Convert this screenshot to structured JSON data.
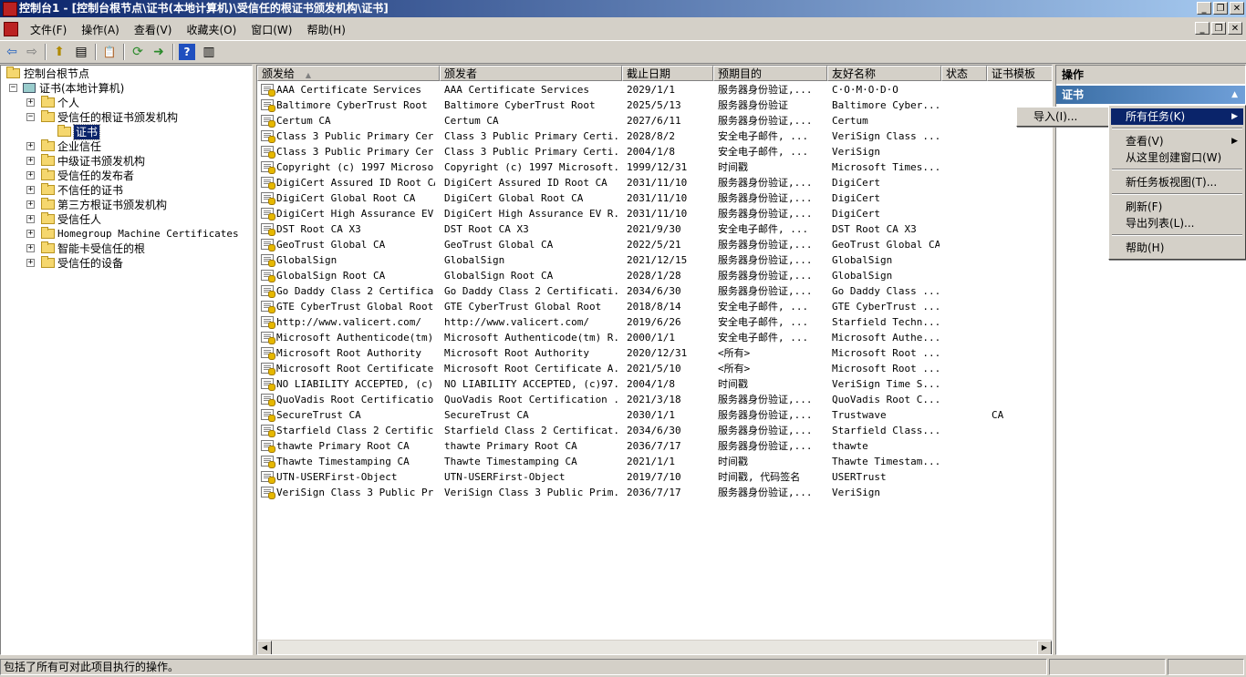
{
  "window": {
    "title": "控制台1 - [控制台根节点\\证书(本地计算机)\\受信任的根证书颁发机构\\证书]",
    "minimize": "_",
    "restore": "❐",
    "close": "✕"
  },
  "menubar": {
    "items": [
      "文件(F)",
      "操作(A)",
      "查看(V)",
      "收藏夹(O)",
      "窗口(W)",
      "帮助(H)"
    ]
  },
  "toolbar": {
    "back": "⇦",
    "forward": "⇨",
    "up": "⬆",
    "show_hide_tree": "▤",
    "properties": "📋",
    "refresh": "⟳",
    "export": "➜",
    "help": "?",
    "show_hide_action": "▥"
  },
  "tree": {
    "root": "控制台根节点",
    "computer": "证书(本地计算机)",
    "nodes": [
      {
        "label": "个人",
        "expandable": true
      },
      {
        "label": "受信任的根证书颁发机构",
        "expandable": false,
        "expanded": true
      },
      {
        "label": "证书",
        "selected": true,
        "child": true
      },
      {
        "label": "企业信任",
        "expandable": true
      },
      {
        "label": "中级证书颁发机构",
        "expandable": true
      },
      {
        "label": "受信任的发布者",
        "expandable": true
      },
      {
        "label": "不信任的证书",
        "expandable": true
      },
      {
        "label": "第三方根证书颁发机构",
        "expandable": true
      },
      {
        "label": "受信任人",
        "expandable": true
      },
      {
        "label": "Homegroup Machine Certificates",
        "expandable": true
      },
      {
        "label": "智能卡受信任的根",
        "expandable": true
      },
      {
        "label": "受信任的设备",
        "expandable": true
      }
    ]
  },
  "list": {
    "sort_indicator": "▲",
    "columns": [
      "颁发给",
      "颁发者",
      "截止日期",
      "预期目的",
      "友好名称",
      "状态",
      "证书模板"
    ],
    "rows": [
      [
        "AAA Certificate Services",
        "AAA Certificate Services",
        "2029/1/1",
        "服务器身份验证,...",
        "C·O·M·O·D·O",
        "",
        ""
      ],
      [
        "Baltimore CyberTrust Root",
        "Baltimore CyberTrust Root",
        "2025/5/13",
        "服务器身份验证",
        "Baltimore Cyber...",
        "",
        ""
      ],
      [
        "Certum CA",
        "Certum CA",
        "2027/6/11",
        "服务器身份验证,...",
        "Certum",
        "",
        ""
      ],
      [
        "Class 3 Public Primary Cer...",
        "Class 3 Public Primary Certi...",
        "2028/8/2",
        "安全电子邮件, ...",
        "VeriSign Class ...",
        "",
        ""
      ],
      [
        "Class 3 Public Primary Cer...",
        "Class 3 Public Primary Certi...",
        "2004/1/8",
        "安全电子邮件, ...",
        "VeriSign",
        "",
        ""
      ],
      [
        "Copyright (c) 1997 Microso...",
        "Copyright (c) 1997 Microsoft...",
        "1999/12/31",
        "时间戳",
        "Microsoft Times...",
        "",
        ""
      ],
      [
        "DigiCert Assured ID Root CA",
        "DigiCert Assured ID Root CA",
        "2031/11/10",
        "服务器身份验证,...",
        "DigiCert",
        "",
        ""
      ],
      [
        "DigiCert Global Root CA",
        "DigiCert Global Root CA",
        "2031/11/10",
        "服务器身份验证,...",
        "DigiCert",
        "",
        ""
      ],
      [
        "DigiCert High Assurance EV...",
        "DigiCert High Assurance EV R...",
        "2031/11/10",
        "服务器身份验证,...",
        "DigiCert",
        "",
        ""
      ],
      [
        "DST Root CA X3",
        "DST Root CA X3",
        "2021/9/30",
        "安全电子邮件, ...",
        "DST Root CA X3",
        "",
        ""
      ],
      [
        "GeoTrust Global CA",
        "GeoTrust Global CA",
        "2022/5/21",
        "服务器身份验证,...",
        "GeoTrust Global CA",
        "",
        ""
      ],
      [
        "GlobalSign",
        "GlobalSign",
        "2021/12/15",
        "服务器身份验证,...",
        "GlobalSign",
        "",
        ""
      ],
      [
        "GlobalSign Root CA",
        "GlobalSign Root CA",
        "2028/1/28",
        "服务器身份验证,...",
        "GlobalSign",
        "",
        ""
      ],
      [
        "Go Daddy Class 2 Certifica...",
        "Go Daddy Class 2 Certificati...",
        "2034/6/30",
        "服务器身份验证,...",
        "Go Daddy Class ...",
        "",
        ""
      ],
      [
        "GTE CyberTrust Global Root",
        "GTE CyberTrust Global Root",
        "2018/8/14",
        "安全电子邮件, ...",
        "GTE CyberTrust ...",
        "",
        ""
      ],
      [
        "http://www.valicert.com/",
        "http://www.valicert.com/",
        "2019/6/26",
        "安全电子邮件, ...",
        "Starfield Techn...",
        "",
        ""
      ],
      [
        "Microsoft Authenticode(tm)...",
        "Microsoft Authenticode(tm) R...",
        "2000/1/1",
        "安全电子邮件, ...",
        "Microsoft Authe...",
        "",
        ""
      ],
      [
        "Microsoft Root Authority",
        "Microsoft Root Authority",
        "2020/12/31",
        "<所有>",
        "Microsoft Root ...",
        "",
        ""
      ],
      [
        "Microsoft Root Certificate...",
        "Microsoft Root Certificate A...",
        "2021/5/10",
        "<所有>",
        "Microsoft Root ...",
        "",
        ""
      ],
      [
        "NO LIABILITY ACCEPTED, (c)...",
        "NO LIABILITY ACCEPTED, (c)97...",
        "2004/1/8",
        "时间戳",
        "VeriSign Time S...",
        "",
        ""
      ],
      [
        "QuoVadis Root Certificatio...",
        "QuoVadis Root Certification ...",
        "2021/3/18",
        "服务器身份验证,...",
        "QuoVadis Root C...",
        "",
        ""
      ],
      [
        "SecureTrust CA",
        "SecureTrust CA",
        "2030/1/1",
        "服务器身份验证,...",
        "Trustwave",
        "",
        "CA"
      ],
      [
        "Starfield Class 2 Certific...",
        "Starfield Class 2 Certificat...",
        "2034/6/30",
        "服务器身份验证,...",
        "Starfield Class...",
        "",
        ""
      ],
      [
        "thawte Primary Root CA",
        "thawte Primary Root CA",
        "2036/7/17",
        "服务器身份验证,...",
        "thawte",
        "",
        ""
      ],
      [
        "Thawte Timestamping CA",
        "Thawte Timestamping CA",
        "2021/1/1",
        "时间戳",
        "Thawte Timestam...",
        "",
        ""
      ],
      [
        "UTN-USERFirst-Object",
        "UTN-USERFirst-Object",
        "2019/7/10",
        "时间戳, 代码签名",
        "USERTrust",
        "",
        ""
      ],
      [
        "VeriSign Class 3 Public Pr...",
        "VeriSign Class 3 Public Prim...",
        "2036/7/17",
        "服务器身份验证,...",
        "VeriSign",
        "",
        ""
      ]
    ],
    "scroll_left": "◀",
    "scroll_right": "▶"
  },
  "actions": {
    "header": "操作",
    "section": "证书",
    "collapse": "▲"
  },
  "context_menu": {
    "items": [
      {
        "label": "所有任务(K)",
        "highlighted": true,
        "submenu": true
      },
      {
        "separator": true
      },
      {
        "label": "查看(V)",
        "submenu": true
      },
      {
        "label": "从这里创建窗口(W)"
      },
      {
        "separator": true
      },
      {
        "label": "新任务板视图(T)..."
      },
      {
        "separator": true
      },
      {
        "label": "刷新(F)"
      },
      {
        "label": "导出列表(L)..."
      },
      {
        "separator": true
      },
      {
        "label": "帮助(H)"
      }
    ],
    "submenu_arrow": "▶"
  },
  "submenu": {
    "import": "导入(I)..."
  },
  "statusbar": {
    "text": "包括了所有可对此项目执行的操作。"
  }
}
